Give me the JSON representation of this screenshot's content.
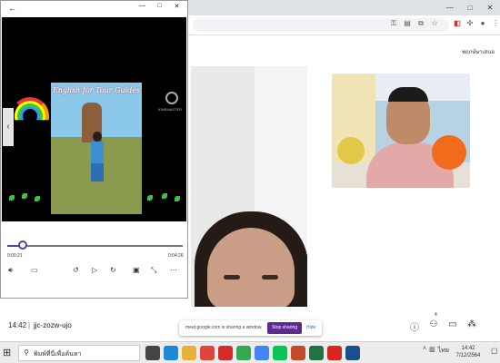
{
  "browser": {
    "window_controls": [
      "—",
      "□",
      "✕"
    ],
    "toolbar_icons": [
      "key-icon",
      "translate-icon",
      "copy-icon",
      "star-icon"
    ],
    "extension_icons": [
      "pdf-extension-icon",
      "puzzle-icon",
      "profile-avatar-icon",
      "menu-icon"
    ]
  },
  "meet": {
    "self_name": "พฤกษ์ษาเสนอ",
    "time": "14:42",
    "separator": "|",
    "meeting_code": "jjc-zozw-ujo",
    "people_count": "4",
    "share_banner": {
      "message": "meet.google.com is sharing a window.",
      "stop_label": "Stop sharing",
      "hide_label": "Hide"
    },
    "bottom_icons": [
      "info-icon",
      "people-icon",
      "chat-icon",
      "activities-icon"
    ]
  },
  "player": {
    "back_label": "←",
    "window_controls": [
      "—",
      "□",
      "✕"
    ],
    "poster_title": "English for Tour Guides",
    "logo_label": "KINEMASTER",
    "progress_fraction": 0.08,
    "current_time": "0:00:21",
    "total_time": "0:04:26",
    "controls": [
      "volume-icon",
      "captions-icon",
      "rewind-10-icon",
      "play-icon",
      "forward-30-icon",
      "aspect-ratio-icon",
      "fullscreen-icon",
      "more-icon"
    ]
  },
  "taskbar": {
    "search_placeholder": "พิมพ์ที่นี่เพื่อค้นหา",
    "apps": [
      {
        "name": "task-view-icon",
        "color": "#444444"
      },
      {
        "name": "edge-icon",
        "color": "#1b8ad6"
      },
      {
        "name": "explorer-icon",
        "color": "#e8b13a"
      },
      {
        "name": "chrome-icon",
        "color": "#e0443a"
      },
      {
        "name": "opera-icon",
        "color": "#d42a2a"
      },
      {
        "name": "chrome-alt-icon",
        "color": "#34a853"
      },
      {
        "name": "chrome-profile-icon",
        "color": "#4285f4"
      },
      {
        "name": "line-icon",
        "color": "#06c755"
      },
      {
        "name": "powerpoint-icon",
        "color": "#c6492a"
      },
      {
        "name": "excel-icon",
        "color": "#217346"
      },
      {
        "name": "acrobat-icon",
        "color": "#d7261e"
      },
      {
        "name": "player-icon",
        "color": "#1a4f8a"
      }
    ],
    "tray_lang": "ไทย",
    "clock_time": "14:42",
    "clock_date": "7/12/2564"
  }
}
